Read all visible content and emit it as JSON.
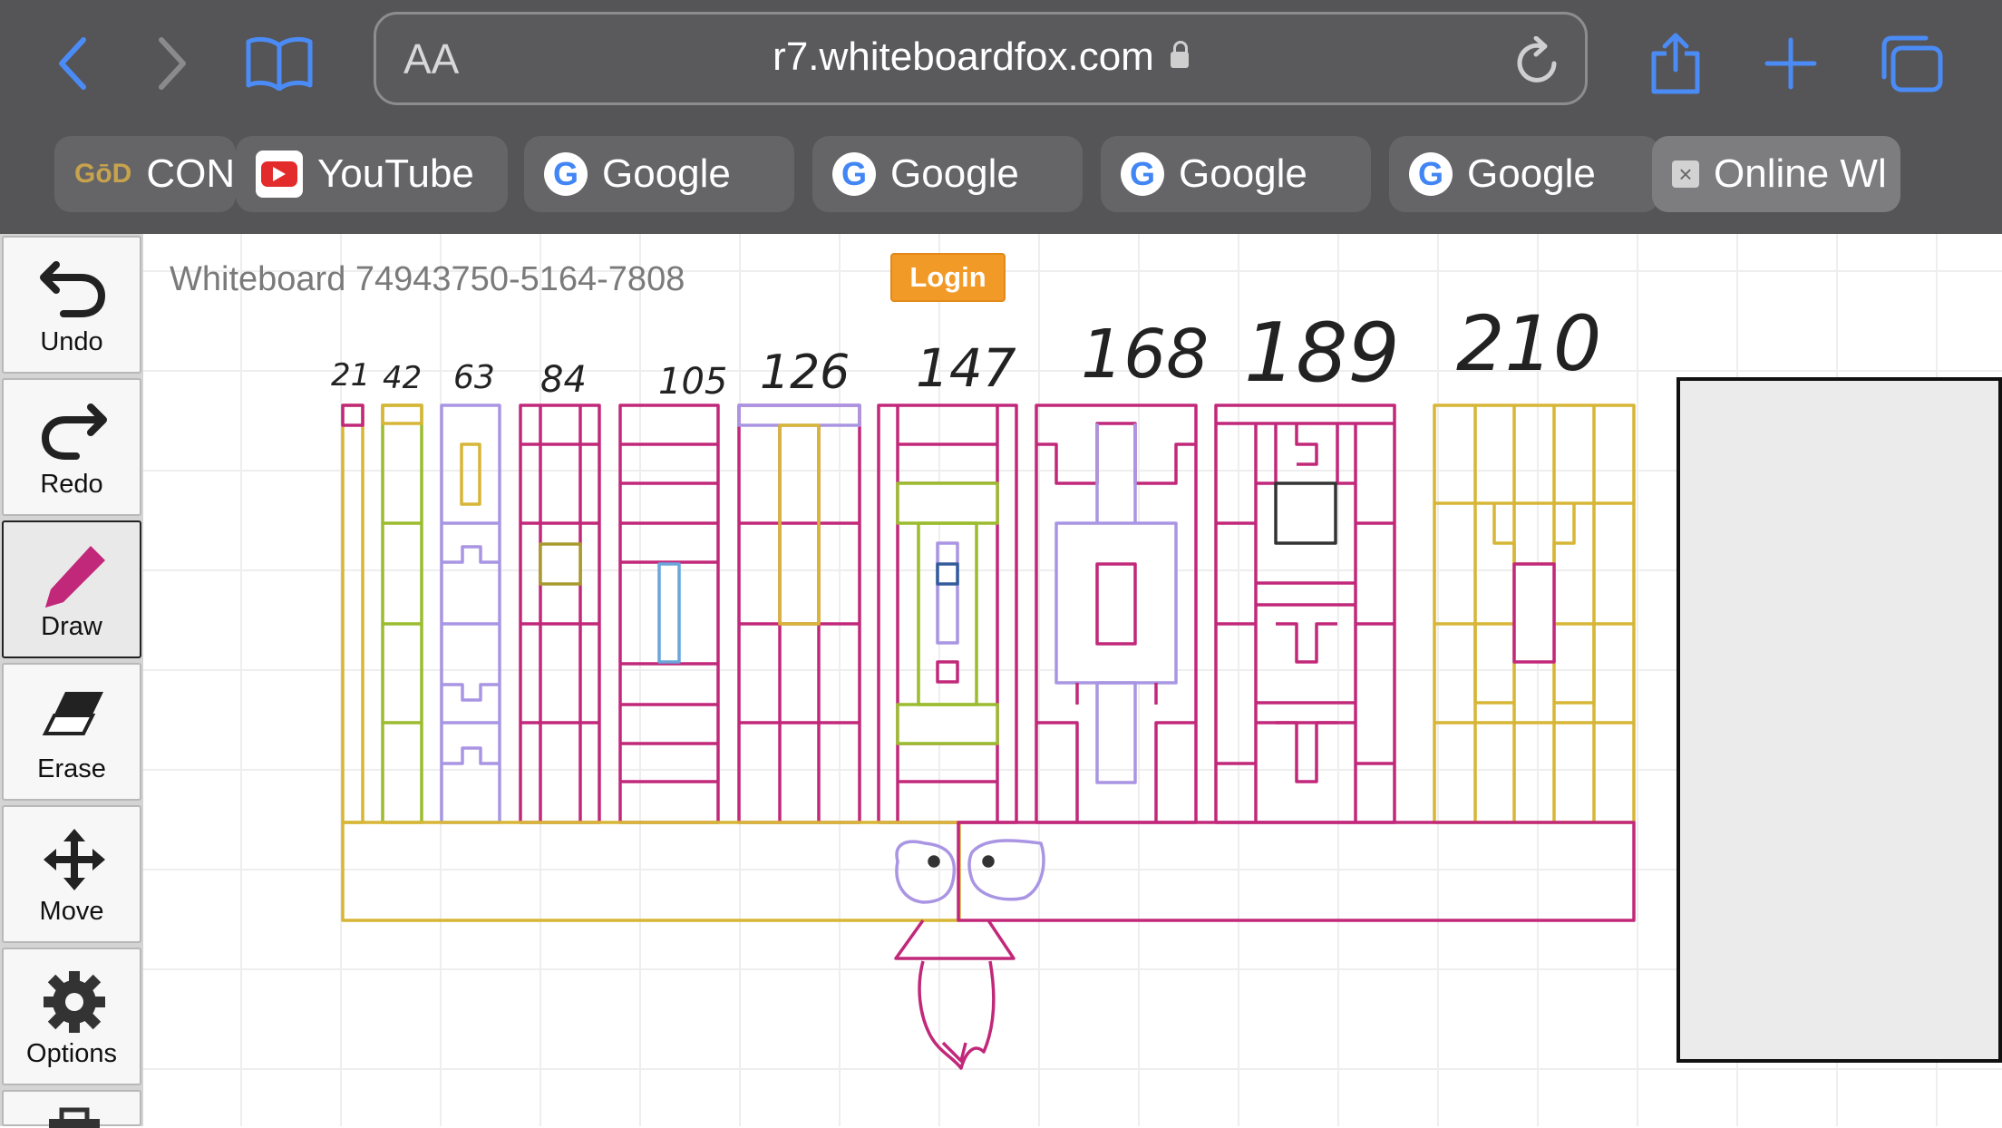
{
  "browser": {
    "font_size_label": "AA",
    "url": "r7.whiteboardfox.com",
    "tabs": [
      {
        "label": "CON",
        "icon": "goldline-logo-icon",
        "icon_text": "GōD"
      },
      {
        "label": "YouTube",
        "icon": "youtube-icon"
      },
      {
        "label": "Google",
        "icon": "google-icon"
      },
      {
        "label": "Google",
        "icon": "google-icon"
      },
      {
        "label": "Google",
        "icon": "google-icon"
      },
      {
        "label": "Google",
        "icon": "google-icon"
      },
      {
        "label": "Online Wl",
        "icon": "close-tab-icon"
      }
    ],
    "google_letter": "G"
  },
  "toolbar": {
    "undo": "Undo",
    "redo": "Redo",
    "draw": "Draw",
    "erase": "Erase",
    "move": "Move",
    "options": "Options"
  },
  "whiteboard": {
    "title": "Whiteboard 74943750-5164-7808",
    "login": "Login",
    "column_labels": [
      "21",
      "42",
      "63",
      "84",
      "105",
      "126",
      "147",
      "168",
      "189",
      "210"
    ]
  },
  "colors": {
    "magenta": "#c2287a",
    "yellow": "#d7b637",
    "green": "#9cbc2f",
    "lavender": "#a995e3",
    "blue": "#6aa7dc",
    "olive": "#a89a2f",
    "dark": "#333333",
    "ios_blue": "#4b8bf5"
  }
}
